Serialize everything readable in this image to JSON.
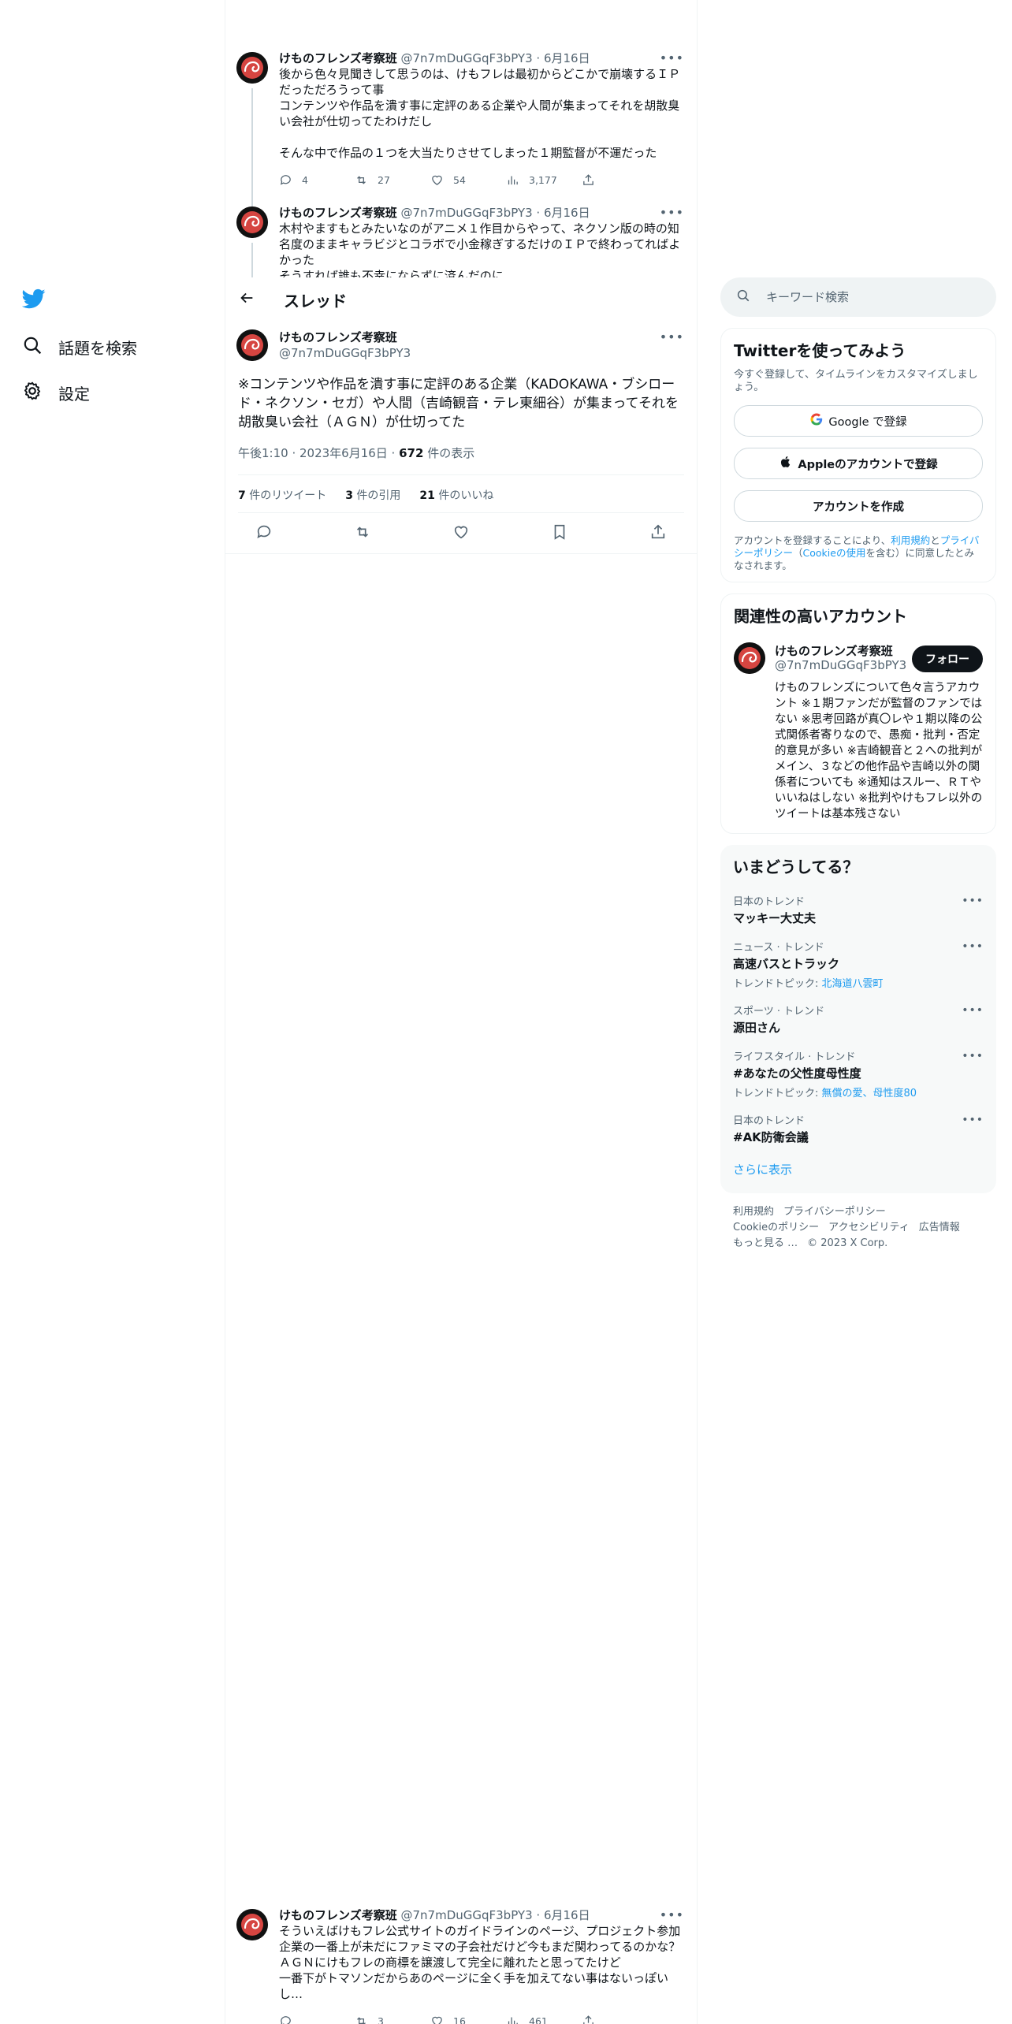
{
  "nav": {
    "items": [
      {
        "label": "話題を検索"
      },
      {
        "label": "設定"
      }
    ]
  },
  "thread_header": {
    "title": "スレッド"
  },
  "tweets_above": [
    {
      "name": "けものフレンズ考察班",
      "handle": "@7n7mDuGGqF3bPY3",
      "date": "6月16日",
      "text": "後から色々見聞きして思うのは、けもフレは最初からどこかで崩壊するＩＰだっただろうって事\nコンテンツや作品を潰す事に定評のある企業や人間が集まってそれを胡散臭い会社が仕切ってたわけだし\n\nそんな中で作品の１つを大当たりさせてしまった１期監督が不運だった",
      "replies": "4",
      "retweets": "27",
      "likes": "54",
      "views": "3,177"
    },
    {
      "name": "けものフレンズ考察班",
      "handle": "@7n7mDuGGqF3bPY3",
      "date": "6月16日",
      "text": "木村やますもとみたいなのがアニメ１作目からやって、ネクソン版の時の知名度のままキャラビジとコラボで小金稼ぎするだけのＩＰで終わってればよかった\nそうすれば誰も不幸にならずに済んだのに"
    }
  ],
  "main_tweet": {
    "name": "けものフレンズ考察班",
    "handle": "@7n7mDuGGqF3bPY3",
    "text": "※コンテンツや作品を潰す事に定評のある企業（KADOKAWA・ブシロード・ネクソン・セガ）や人間（吉崎観音・テレ東細谷）が集まってそれを胡散臭い会社（ＡＧＮ）が仕切ってた",
    "time": "午後1:10 · 2023年6月16日 · ",
    "views_count": "672",
    "views_label": " 件の表示",
    "retweets_count": "7",
    "retweets_label": " 件のリツイート",
    "quotes_count": "3",
    "quotes_label": " 件の引用",
    "likes_count": "21",
    "likes_label": " 件のいいね"
  },
  "tweet_below": {
    "name": "けものフレンズ考察班",
    "handle": "@7n7mDuGGqF3bPY3",
    "date": "6月16日",
    "text": "そういえばけもフレ公式サイトのガイドラインのページ、プロジェクト参加企業の一番上が未だにファミマの子会社だけど今もまだ関わってるのかな？\nＡＧＮにけもフレの商標を譲渡して完全に離れたと思ってたけど\n一番下がトマソンだからあのページに全く手を加えてない事はないっぽいし…",
    "retweets": "3",
    "likes": "16",
    "views": "461"
  },
  "search": {
    "placeholder": "キーワード検索"
  },
  "signup": {
    "title": "Twitterを使ってみよう",
    "subtitle": "今すぐ登録して、タイムラインをカスタマイズしましょう。",
    "google": "Google で登録",
    "apple": "Appleのアカウントで登録",
    "create": "アカウントを作成",
    "terms_pre": "アカウントを登録することにより、",
    "terms_link1": "利用規約",
    "terms_mid1": "と",
    "terms_link2": "プライバシーポリシー",
    "terms_mid2": "（",
    "terms_link3": "Cookieの使用",
    "terms_post": "を含む）に同意したとみなされます。"
  },
  "related": {
    "title": "関連性の高いアカウント",
    "name": "けものフレンズ考察班",
    "handle": "@7n7mDuGGqF3bPY3",
    "follow": "フォロー",
    "bio": "けものフレンズについて色々言うアカウント ※１期ファンだが監督のファンではない ※思考回路が真〇レや１期以降の公式関係者寄りなので、愚痴・批判・否定的意見が多い ※吉崎観音と２への批判がメイン、３などの他作品や吉崎以外の関係者についても ※通知はスルー、ＲＴやいいねはしない ※批判やけもフレ以外のツイートは基本残さない"
  },
  "trends": {
    "title": "いまどうしてる？",
    "items": [
      {
        "category": "日本のトレンド",
        "name": "マッキー大丈夫"
      },
      {
        "category": "ニュース · トレンド",
        "name": "高速バスとトラック",
        "topic_label": "トレンドトピック: ",
        "topic": "北海道八雲町"
      },
      {
        "category": "スポーツ · トレンド",
        "name": "源田さん"
      },
      {
        "category": "ライフスタイル · トレンド",
        "name": "#あなたの父性度母性度",
        "topic_label": "トレンドトピック: ",
        "topic": "無償の愛、母性度80"
      },
      {
        "category": "日本のトレンド",
        "name": "#AK防衛会議"
      }
    ],
    "show_more": "さらに表示"
  },
  "footer": {
    "links": [
      "利用規約",
      "プライバシーポリシー",
      "Cookieのポリシー",
      "アクセシビリティ",
      "広告情報",
      "もっと見る …"
    ],
    "copyright": "© 2023 X Corp."
  },
  "colors": {
    "accent": "#1d9bf0",
    "text": "#0f1419",
    "secondary": "#536471"
  }
}
